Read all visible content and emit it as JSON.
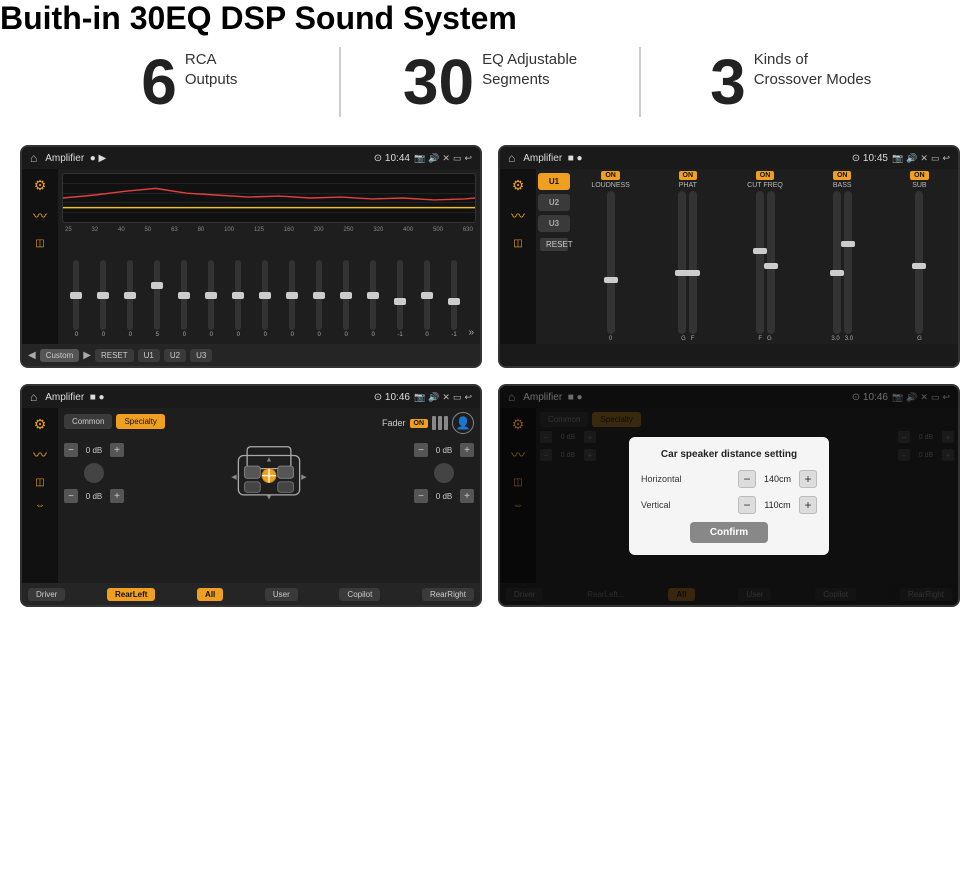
{
  "header": {
    "title": "Buith-in 30EQ DSP Sound System"
  },
  "stats": [
    {
      "number": "6",
      "line1": "RCA",
      "line2": "Outputs"
    },
    {
      "number": "30",
      "line1": "EQ Adjustable",
      "line2": "Segments"
    },
    {
      "number": "3",
      "line1": "Kinds of",
      "line2": "Crossover Modes"
    }
  ],
  "screens": [
    {
      "id": "eq-screen",
      "statusBar": {
        "app": "Amplifier",
        "time": "10:44"
      },
      "type": "eq"
    },
    {
      "id": "amp-screen",
      "statusBar": {
        "app": "Amplifier",
        "time": "10:45"
      },
      "type": "amp"
    },
    {
      "id": "speaker-screen",
      "statusBar": {
        "app": "Amplifier",
        "time": "10:46"
      },
      "type": "speaker"
    },
    {
      "id": "dialog-screen",
      "statusBar": {
        "app": "Amplifier",
        "time": "10:46"
      },
      "type": "dialog"
    }
  ],
  "eq": {
    "frequencies": [
      "25",
      "32",
      "40",
      "50",
      "63",
      "80",
      "100",
      "125",
      "160",
      "200",
      "250",
      "320",
      "400",
      "500",
      "630"
    ],
    "values": [
      "0",
      "0",
      "0",
      "5",
      "0",
      "0",
      "0",
      "0",
      "0",
      "0",
      "0",
      "0",
      "-1",
      "0",
      "-1"
    ],
    "presets": [
      "Custom",
      "RESET",
      "U1",
      "U2",
      "U3"
    ],
    "sliderPositions": [
      50,
      50,
      50,
      35,
      50,
      50,
      50,
      50,
      50,
      50,
      50,
      50,
      65,
      50,
      65
    ]
  },
  "amp": {
    "presets": [
      "U1",
      "U2",
      "U3"
    ],
    "channels": [
      "LOUDNESS",
      "PHAT",
      "CUT FREQ",
      "BASS",
      "SUB"
    ],
    "onStates": [
      true,
      true,
      true,
      true,
      true
    ]
  },
  "speaker": {
    "tabs": [
      "Common",
      "Specialty"
    ],
    "activeTab": "Specialty",
    "faderLabel": "Fader",
    "faderOn": true,
    "leftTop": "0 dB",
    "leftBottom": "0 dB",
    "rightTop": "0 dB",
    "rightBottom": "0 dB",
    "buttons": [
      "Driver",
      "RearLeft",
      "All",
      "User",
      "Copilot",
      "RearRight"
    ]
  },
  "dialog": {
    "title": "Car speaker distance setting",
    "horizontalLabel": "Horizontal",
    "horizontalValue": "140cm",
    "verticalLabel": "Vertical",
    "verticalValue": "110cm",
    "confirmLabel": "Confirm",
    "dBRight1": "0 dB",
    "dBRight2": "0 dB"
  }
}
